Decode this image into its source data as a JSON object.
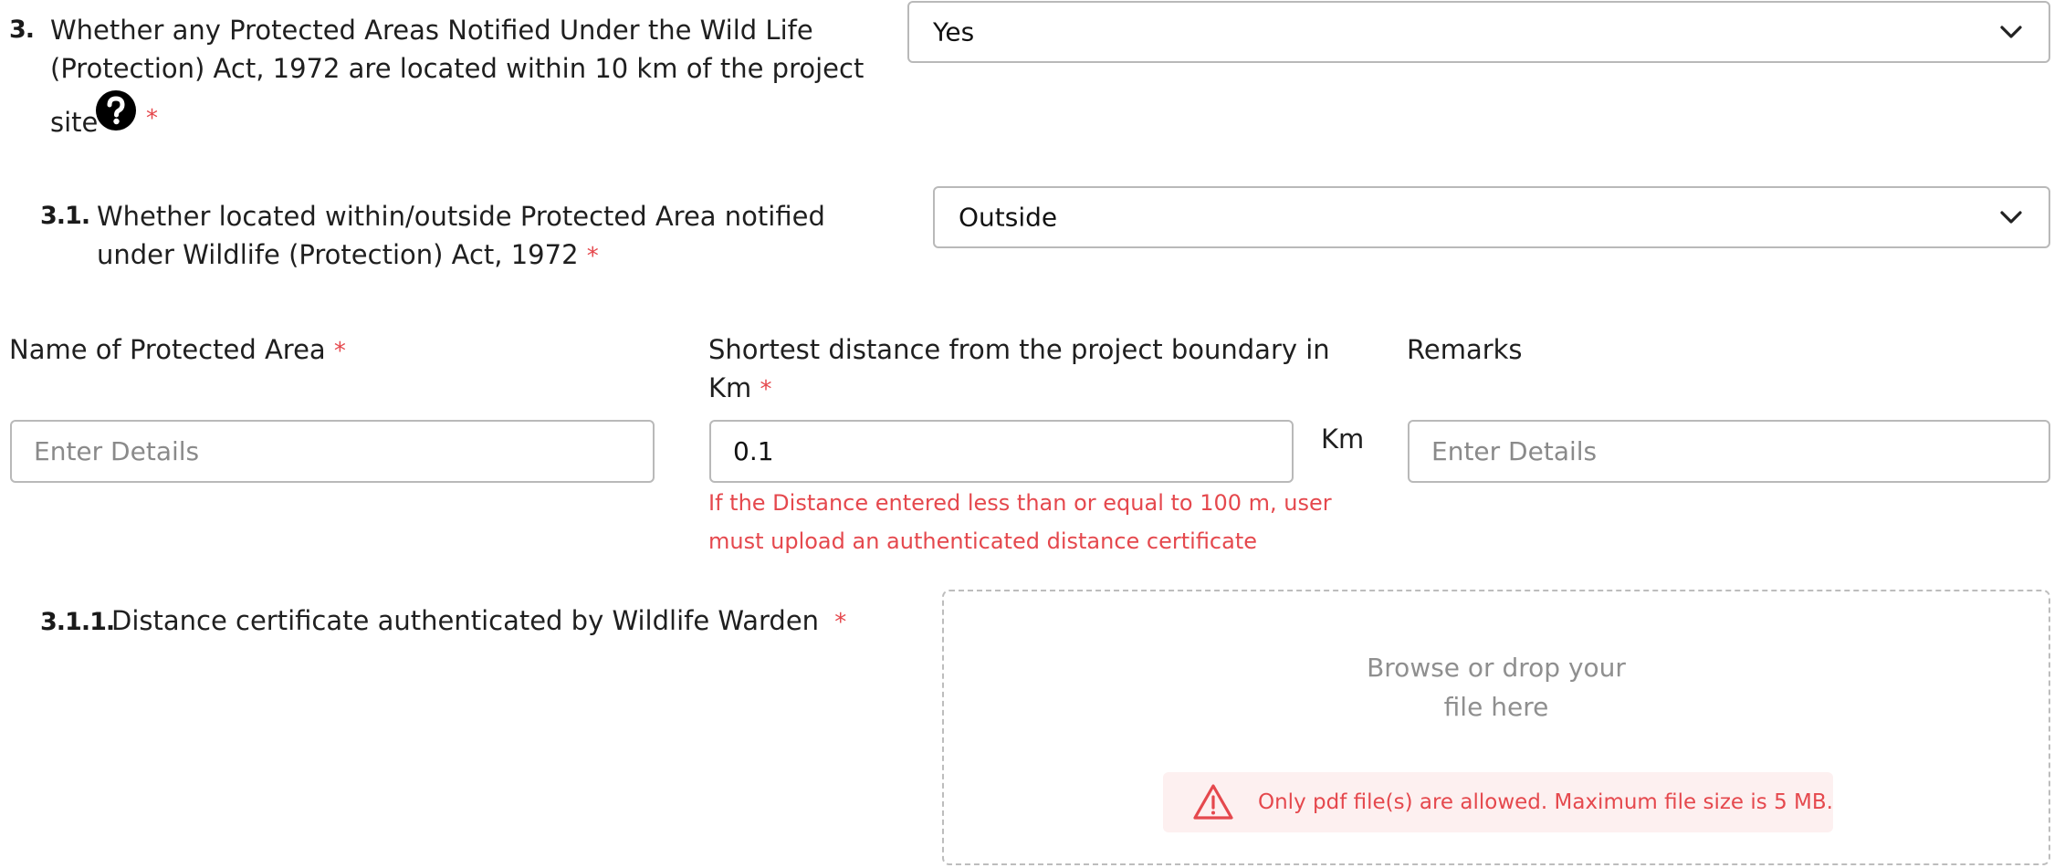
{
  "q3": {
    "number": "3.",
    "line1": "Whether any Protected Areas Notified Under the Wild Life",
    "line2": "(Protection) Act, 1972 are located within 10 km of the project",
    "line3": "site",
    "required": "*",
    "select_value": "Yes"
  },
  "q3_1": {
    "number": "3.1.",
    "line1": "Whether located within/outside Protected Area notified",
    "line2": "under Wildlife (Protection) Act, 1972",
    "required": "*",
    "select_value": "Outside"
  },
  "fields": {
    "name_label": "Name of Protected Area",
    "name_required": "*",
    "name_placeholder": "Enter Details",
    "distance_label_line1": "Shortest distance from the project boundary in",
    "distance_label_line2": "Km",
    "distance_required": "*",
    "distance_value": "0.1",
    "distance_unit": "Km",
    "distance_error_line1": "If the Distance entered less than or equal to 100 m, user",
    "distance_error_line2": "must upload an authenticated distance certificate",
    "remarks_label": "Remarks",
    "remarks_placeholder": "Enter Details"
  },
  "q3_1_1": {
    "number": "3.1.1.",
    "label": "Distance certificate authenticated by Wildlife Warden",
    "required": "*",
    "drop_line1": "Browse or drop your",
    "drop_line2": "file here",
    "notice": "Only pdf file(s) are allowed. Maximum file size is 5 MB."
  },
  "icons": {
    "help": "question-circle-icon",
    "chevron": "chevron-down-icon",
    "warning": "warning-triangle-icon"
  },
  "colors": {
    "required": "#e5484d",
    "error": "#e5484d",
    "border": "#b9b9b9",
    "notice_bg": "#fdf0f0"
  }
}
